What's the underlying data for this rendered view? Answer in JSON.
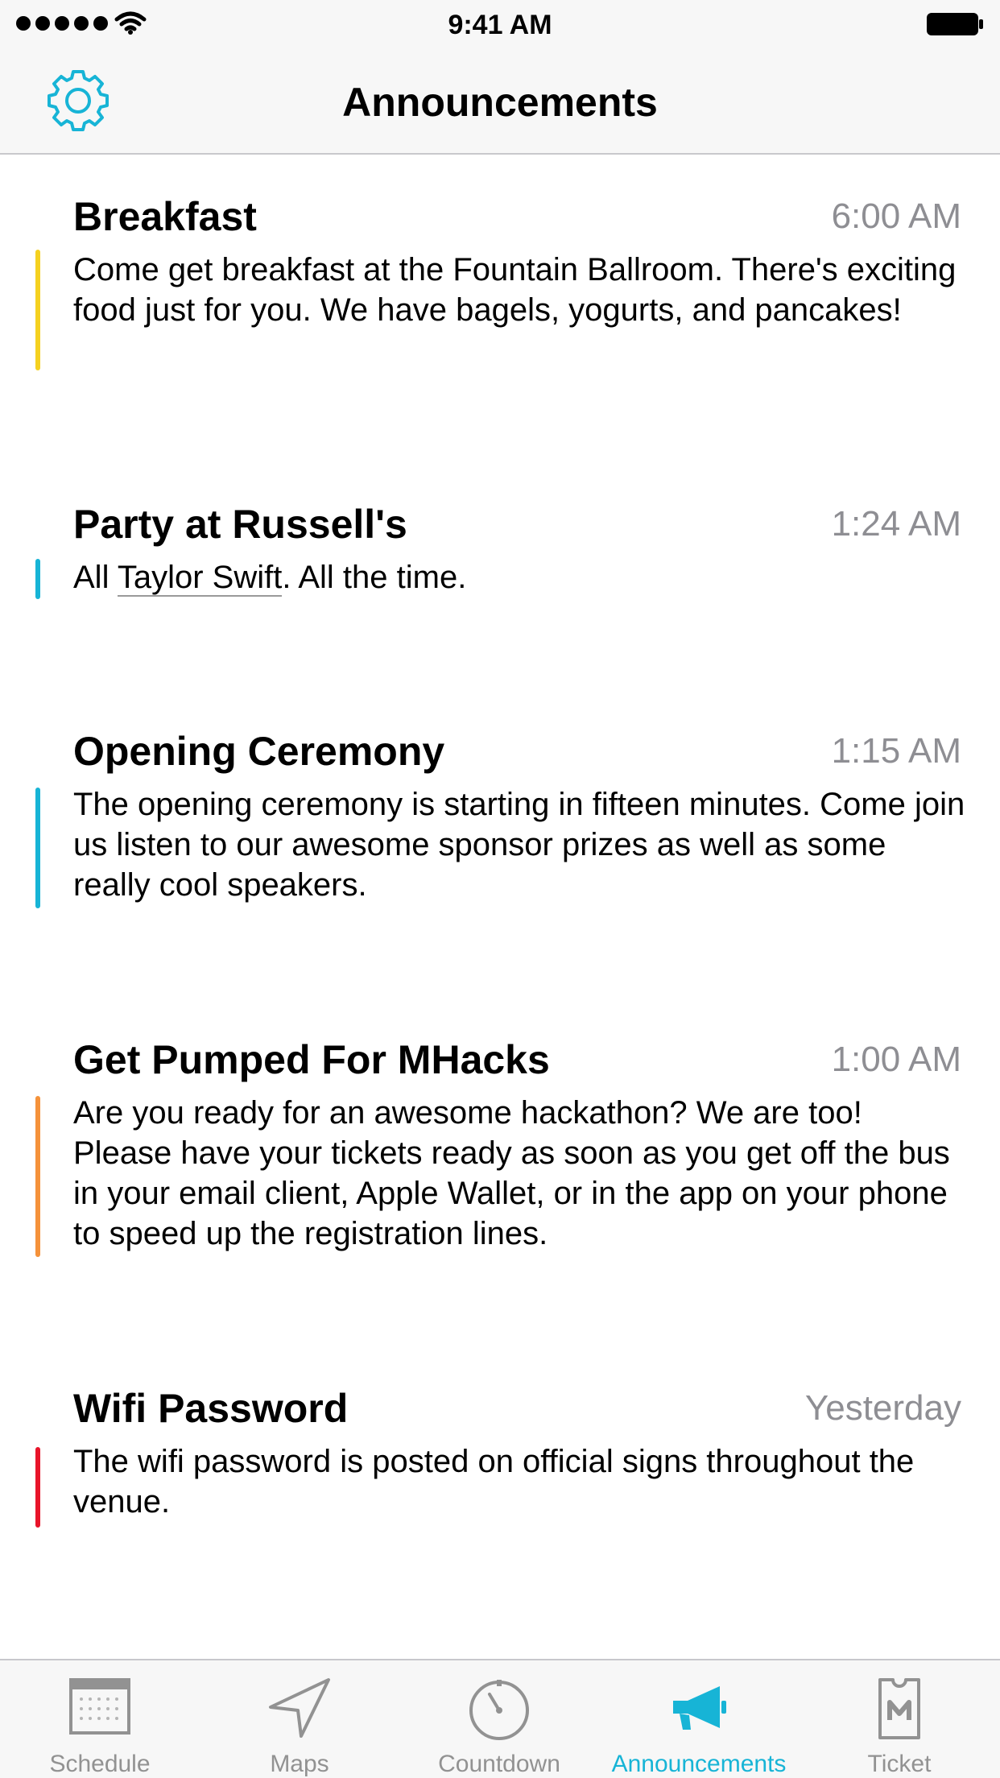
{
  "status_bar": {
    "time": "9:41 AM"
  },
  "nav": {
    "title": "Announcements",
    "settings_icon": "gear-icon"
  },
  "colors": {
    "accent": "#17b4d6",
    "inactive": "#929292",
    "yellow": "#f5d120",
    "cyan": "#17b4d6",
    "orange": "#f5923a",
    "red": "#e8142a"
  },
  "announcements": [
    {
      "title": "Breakfast",
      "time": "6:00 AM",
      "body": "Come get breakfast at the Fountain Ballroom. There's exciting food just for you. We have bagels, yogurts, and pancakes!",
      "color": "yellow"
    },
    {
      "title": "Party at Russell's",
      "time": "1:24 AM",
      "body_prefix": "All ",
      "body_link": "Taylor Swift",
      "body_suffix": ". All the time.",
      "color": "cyan"
    },
    {
      "title": "Opening Ceremony",
      "time": "1:15 AM",
      "body": "The opening ceremony is starting in fifteen minutes. Come join us listen to our awesome sponsor prizes as well as some really cool speakers.",
      "color": "cyan"
    },
    {
      "title": "Get Pumped For MHacks",
      "time": "1:00 AM",
      "body": "Are you ready for an awesome hackathon? We are too! Please have your tickets ready as soon as you get off the bus in your email client, Apple Wallet, or in the app on your phone to speed up the registration lines.",
      "color": "orange"
    },
    {
      "title": "Wifi Password",
      "time": "Yesterday",
      "body": "The wifi password is posted on official signs throughout the venue.",
      "color": "red"
    }
  ],
  "tabs": [
    {
      "label": "Schedule",
      "icon": "calendar-icon"
    },
    {
      "label": "Maps",
      "icon": "navigation-arrow-icon"
    },
    {
      "label": "Countdown",
      "icon": "stopwatch-icon"
    },
    {
      "label": "Announcements",
      "icon": "megaphone-icon",
      "active": true
    },
    {
      "label": "Ticket",
      "icon": "ticket-icon"
    }
  ]
}
